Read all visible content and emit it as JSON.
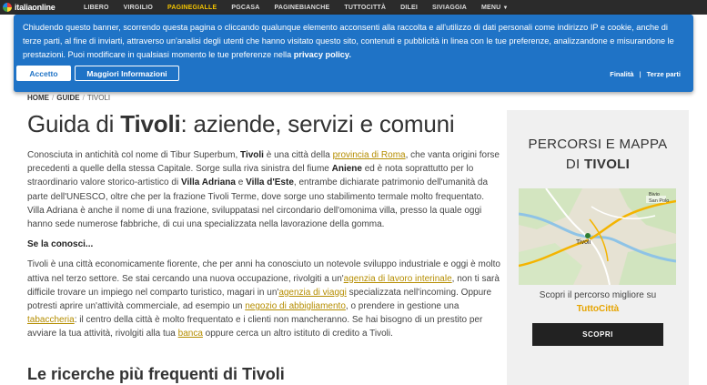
{
  "nav": {
    "logo": "italiaonline",
    "items": [
      {
        "label": "LIBERO",
        "active": false
      },
      {
        "label": "VIRGILIO",
        "active": false
      },
      {
        "label": "PAGINEGIALLE",
        "active": true
      },
      {
        "label": "PGCASA",
        "active": false
      },
      {
        "label": "PAGINEBIANCHE",
        "active": false
      },
      {
        "label": "TUTTOCITTÀ",
        "active": false
      },
      {
        "label": "DILEI",
        "active": false
      },
      {
        "label": "SIVIAGGIA",
        "active": false
      },
      {
        "label": "MENU",
        "active": false
      }
    ]
  },
  "cookie": {
    "text": "Chiudendo questo banner, scorrendo questa pagina o cliccando qualunque elemento acconsenti alla raccolta e all'utilizzo di dati personali come indirizzo IP e cookie, anche di terze parti, al fine di inviarti, attraverso un'analisi degli utenti che hanno visitato questo sito, contenuti e pubblicità in linea con le tue preferenze, analizzandone e misurandone le prestazioni. Puoi modificare in qualsiasi momento le tue preferenze nella",
    "policy_link": "privacy policy.",
    "accept_label": "Accetto",
    "more_label": "Maggiori Informazioni",
    "link_finalita": "Finalità",
    "link_terze": "Terze parti"
  },
  "breadcrumb": {
    "home": "HOME",
    "guide": "GUIDE",
    "current": "TIVOLI"
  },
  "title": {
    "prefix": "Guida di ",
    "city": "Tivoli",
    "suffix": ": aziende, servizi e comuni"
  },
  "article": {
    "p1": {
      "t1": "Conosciuta in antichità col nome di Tibur Superbum, ",
      "b1": "Tivoli",
      "t2": " è una città della ",
      "l1": "provincia di Roma",
      "t3": ", che vanta origini forse precedenti a quelle della stessa Capitale. Sorge sulla riva sinistra del fiume ",
      "b2": "Aniene",
      "t4": " ed è nota soprattutto per lo straordinario valore storico-artistico di ",
      "b3": "Villa Adriana",
      "t5": " e ",
      "b4": "Villa d'Este",
      "t6": ", entrambe dichiarate patrimonio dell'umanità da parte dell'UNESCO, oltre che per la frazione Tivoli Terme, dove sorge uno stabilimento termale molto frequentato. Villa Adriana è anche il nome di una frazione, sviluppatasi nel circondario dell'omonima villa, presso la quale oggi hanno sede numerose fabbriche, di cui una specializzata nella lavorazione della gomma."
    },
    "subhead": "Se la conosci...",
    "p2": {
      "t1": "Tivoli è una città economicamente fiorente, che per anni ha conosciuto un notevole sviluppo industriale e oggi è molto attiva nel terzo settore. Se stai cercando una nuova occupazione, rivolgiti a un'",
      "l1": "agenzia di lavoro interinale",
      "t2": ", non ti sarà difficile trovare un impiego nel comparto turistico, magari in un'",
      "l2": "agenzia di viaggi",
      "t3": " specializzata nell'incoming. Oppure potresti aprire un'attività commerciale, ad esempio un ",
      "l3": "negozio di abbigliamento",
      "t4": ", o prendere in gestione una ",
      "l4": "tabaccheria",
      "t5": ": il centro della città è molto frequentato e i clienti non mancheranno. Se hai bisogno di un prestito per avviare la tua attività, rivolgiti alla tua ",
      "l5": "banca",
      "t6": " oppure cerca un altro istituto di credito a Tivoli."
    }
  },
  "section": {
    "prefix": "Le ricerche più frequenti di ",
    "city": "Tivoli"
  },
  "sidebar": {
    "title_line1": "PERCORSI E MAPPA",
    "title_prefix": "DI ",
    "title_city": "TIVOLI",
    "map": {
      "label_tivoli": "Tivoli",
      "label_bivio": "Bivio",
      "label_sanpolo": "San Polo"
    },
    "caption": "Scopri il percorso migliore su",
    "brand": "TuttoCittà",
    "button_label": "SCOPRI"
  }
}
